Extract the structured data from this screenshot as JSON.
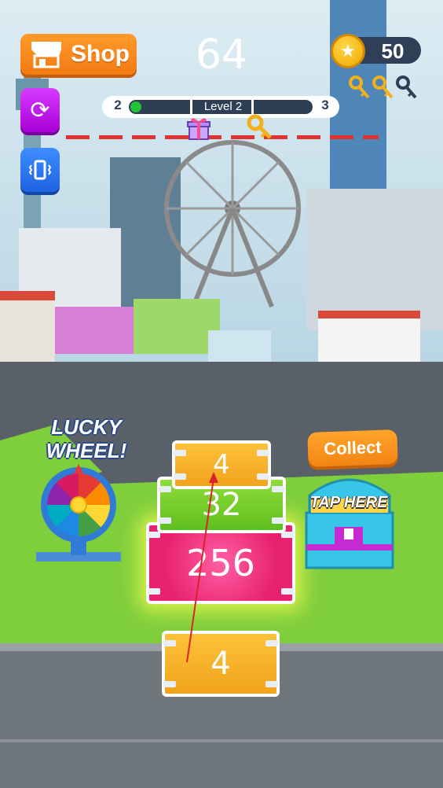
{
  "hud": {
    "shop_label": "Shop",
    "score": "64",
    "coins": "50",
    "keys_icon": "key-icon",
    "keys_collected": 2,
    "keys_total": 3
  },
  "level": {
    "current": "2",
    "next": "3",
    "label": "Level 2",
    "progress_fraction": 0.05
  },
  "lucky_wheel": {
    "title": "LUCKY WHEEL!"
  },
  "stack": {
    "top": "4",
    "middle": "32",
    "bottom": "256",
    "player_box": "4"
  },
  "chest": {
    "collect_label": "Collect",
    "tap_label": "TAP HERE"
  },
  "colors": {
    "shop": "#f27a12",
    "box_4": "#f2a31c",
    "box_32": "#5fbf1f",
    "box_256": "#e8226e",
    "limit_line": "#e03131",
    "progress": "#22c53a"
  }
}
